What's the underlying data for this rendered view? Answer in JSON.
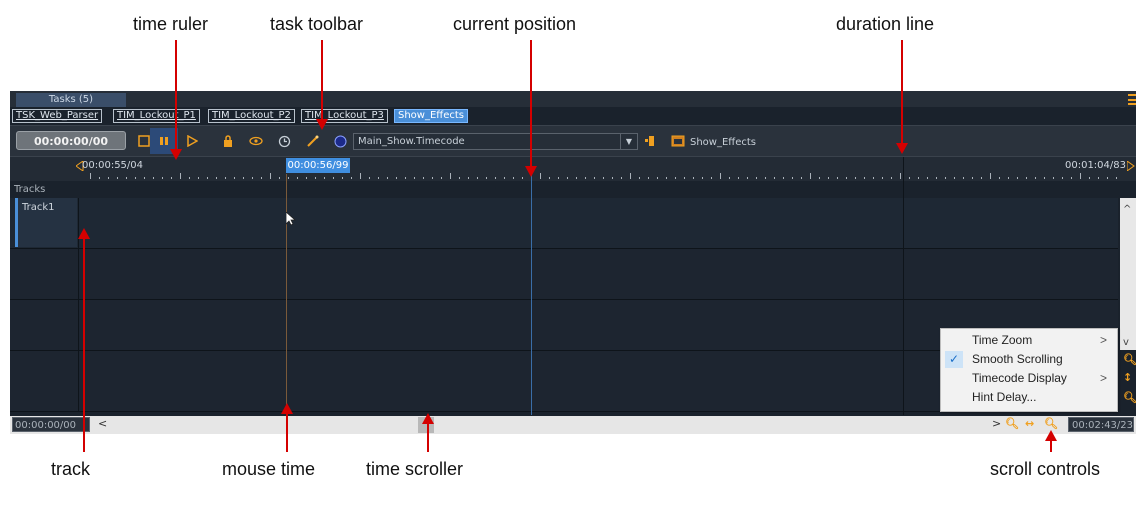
{
  "annotations": {
    "time_ruler": "time ruler",
    "task_toolbar": "task toolbar",
    "current_position": "current position",
    "duration_line": "duration line",
    "track": "track",
    "mouse_time": "mouse time",
    "time_scroller": "time scroller",
    "scroll_controls": "scroll controls"
  },
  "tasks_tab": "Tasks (5)",
  "task_tabs": [
    "TSK_Web_Parser",
    "TIM_Lockout_P1",
    "TIM_Lockout_P2",
    "TIM_Lockout_P3",
    "Show_Effects"
  ],
  "toolbar": {
    "timecode": "00:00:00/00",
    "timecode_source": "Main_Show.Timecode",
    "show_name": "Show_Effects"
  },
  "ruler": {
    "start": "00:00:55/04",
    "mouse_time": "00:00:56/99",
    "end": "00:01:04/83"
  },
  "tracks_header": "Tracks",
  "track1": "Track1",
  "bottom": {
    "start_time": "00:00:00/00",
    "end_time": "00:02:43/23"
  },
  "context_menu": {
    "items": [
      {
        "label": "Time Zoom",
        "submenu": true,
        "checked": false
      },
      {
        "label": "Smooth Scrolling",
        "submenu": false,
        "checked": true
      },
      {
        "label": "Timecode Display",
        "submenu": true,
        "checked": false
      },
      {
        "label": "Hint Delay...",
        "submenu": false,
        "checked": false
      }
    ]
  },
  "colors": {
    "accent_blue": "#4a8fd8",
    "toolbar_orange": "#f0a020",
    "annotation_red": "#d40000"
  }
}
